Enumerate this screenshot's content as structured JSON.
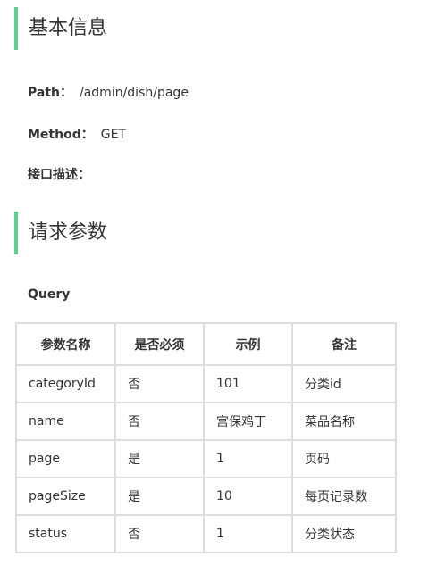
{
  "section1": {
    "title": "基本信息",
    "path_label": "Path：",
    "path": "/admin/dish/page",
    "method_label": "Method：",
    "method": "GET",
    "desc_label": "接口描述："
  },
  "section2": {
    "title": "请求参数",
    "query_label": "Query",
    "headers": [
      "参数名称",
      "是否必须",
      "示例",
      "备注"
    ],
    "rows": [
      [
        "categoryId",
        "否",
        "101",
        "分类id"
      ],
      [
        "name",
        "否",
        "宫保鸡丁",
        "菜品名称"
      ],
      [
        "page",
        "是",
        "1",
        "页码"
      ],
      [
        "pageSize",
        "是",
        "10",
        "每页记录数"
      ],
      [
        "status",
        "否",
        "1",
        "分类状态"
      ]
    ]
  },
  "accent": "#5cd08d"
}
